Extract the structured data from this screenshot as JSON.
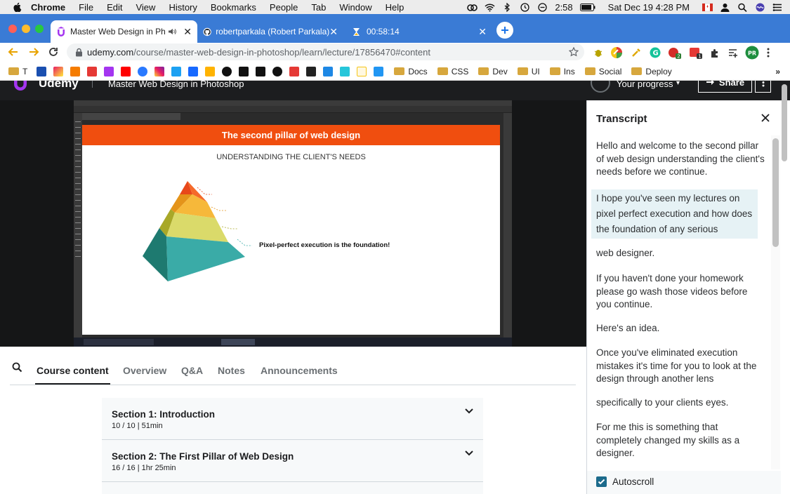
{
  "menubar": {
    "app": "Chrome",
    "items": [
      "File",
      "Edit",
      "View",
      "History",
      "Bookmarks",
      "People",
      "Tab",
      "Window",
      "Help"
    ],
    "time_left": "2:58",
    "clock": "Sat Dec 19  4:28 PM"
  },
  "tabs": [
    {
      "title": "Master Web Design in Phot",
      "active": true
    },
    {
      "title": "robertparkala (Robert Parkala)",
      "active": false
    },
    {
      "title": "00:58:14",
      "active": false
    }
  ],
  "address": {
    "host": "udemy.com",
    "path": "/course/master-web-design-in-photoshop/learn/lecture/17856470#content"
  },
  "bookmarks": {
    "first_label": "T",
    "folders": [
      "Docs",
      "CSS",
      "Dev",
      "UI",
      "Ins",
      "Social",
      "Deploy"
    ]
  },
  "udemy_header": {
    "logo": "Udemy",
    "course_title": "Master Web Design in Photoshop",
    "progress_label": "Your progress",
    "share_label": "Share"
  },
  "slide": {
    "title": "The second pillar of web design",
    "subtitle": "UNDERSTANDING THE CLIENT'S NEEDS",
    "caption": "Pixel-perfect execution is the foundation!"
  },
  "course_tabs": [
    "Course content",
    "Overview",
    "Q&A",
    "Notes",
    "Announcements"
  ],
  "sections": [
    {
      "title": "Section 1: Introduction",
      "meta": "10 / 10 | 51min"
    },
    {
      "title": "Section 2: The First Pillar of Web Design",
      "meta": "16 / 16 | 1hr 25min"
    }
  ],
  "transcript": {
    "title": "Transcript",
    "paragraphs": [
      "Hello and welcome to the second pillar of web design understanding the client's needs before we continue.",
      "I hope you've seen my lectures on pixel perfect execution and how does the foundation of any serious",
      "web designer.",
      "If you haven't done your homework please go wash those videos before you continue.",
      "Here's an idea.",
      "Once you've eliminated execution mistakes it's time for you to look at the design through another lens",
      "specifically to your clients eyes.",
      "For me this is something that completely changed my skills as a designer."
    ],
    "autoscroll_label": "Autoscroll"
  },
  "colors": {
    "tabstrip": "#3a7bd5",
    "slide_bar": "#f04e0f",
    "udemy_dark": "#1c1d1f"
  }
}
